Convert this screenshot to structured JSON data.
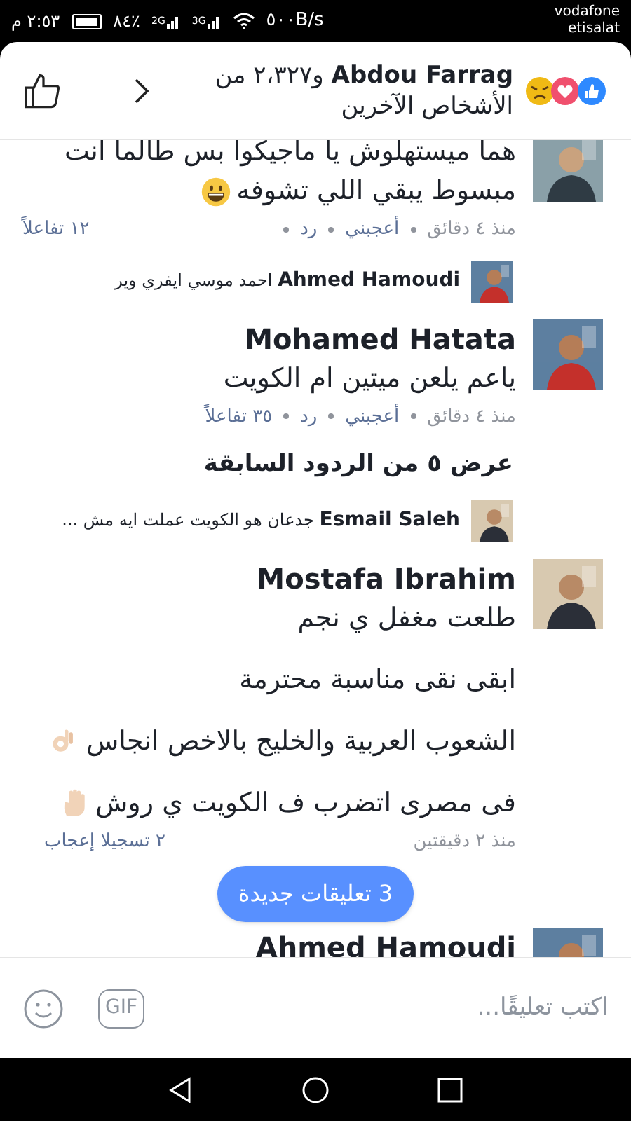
{
  "status_bar": {
    "carriers": [
      "vodafone",
      "etisalat"
    ],
    "speed": "٥٠٠B/s",
    "networks": [
      "3G",
      "2G"
    ],
    "battery": "٨٤٪",
    "time": "٢:٥٣ م"
  },
  "header": {
    "title": "**Abdou Farrag** و٢،٣٢٧ من الأشخاص الآخرين"
  },
  "comments": [
    {
      "kind": "comment",
      "paragraphs": [
        {
          "kind": "grin_emoji",
          "text": "هما ميستهلوش يا ماجيكوا بس طالما انت مبسوط يبقي اللي تشوفه"
        }
      ],
      "meta": {
        "time": "منذ ٤ دقائق",
        "like": "أعجبني",
        "reply": "رد",
        "reactions": "١٢ تفاعلاً"
      }
    },
    {
      "kind": "reply",
      "name": "Ahmed Hamoudi",
      "text": "احمد موسي ايفري وير"
    },
    {
      "kind": "comment",
      "name": "Mohamed Hatata",
      "paragraphs": [
        {
          "kind": "plain",
          "text": "ياعم يلعن ميتين ام الكويت"
        }
      ],
      "meta": {
        "time": "منذ ٤ دقائق",
        "like": "أعجبني",
        "reply": "رد",
        "reactions": "٣٥ تفاعلاً"
      }
    },
    {
      "kind": "more",
      "text": "عرض ٥ من الردود السابقة"
    },
    {
      "kind": "reply",
      "name": "Esmail Saleh",
      "text": "جدعان هو الكويت عملت ايه مش ..."
    },
    {
      "kind": "comment",
      "name": "Mostafa Ibrahim",
      "paragraphs": [
        {
          "kind": "plain",
          "text": "طلعت مغفل ي نجم"
        },
        {
          "kind": "plain",
          "text": "ابقى نقى مناسبة محترمة"
        },
        {
          "kind": "ok_emoji",
          "text": "الشعوب العربية والخليج بالاخص انجاس"
        },
        {
          "kind": "hand_emoji",
          "text": "فى مصرى اتضرب ف الكويت ي روش"
        }
      ],
      "meta": {
        "time": "منذ ٢ دقيقتين",
        "reactions": "٢ تسجيلا إعجاب"
      }
    },
    {
      "kind": "comment",
      "name": "Ahmed Hamoudi"
    }
  ],
  "new_comments": {
    "label": "3 تعليقات جديدة"
  },
  "composer": {
    "placeholder": "اكتب تعليقًا...",
    "gif": "GIF"
  }
}
